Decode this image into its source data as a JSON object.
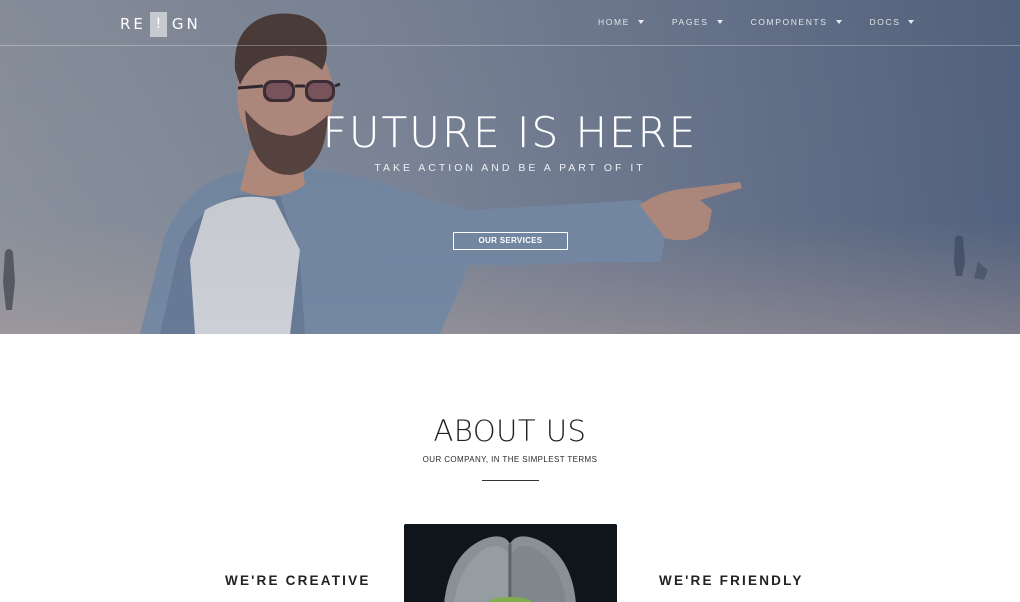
{
  "brand": {
    "prefix": "RE",
    "mark": "!",
    "suffix": "GN"
  },
  "nav": {
    "items": [
      {
        "label": "HOME"
      },
      {
        "label": "PAGES"
      },
      {
        "label": "COMPONENTS"
      },
      {
        "label": "DOCS"
      }
    ]
  },
  "hero": {
    "title": "FUTURE IS HERE",
    "subtitle": "TAKE ACTION AND BE A PART OF IT",
    "button_label": "OUR SERVICES"
  },
  "about": {
    "title": "ABOUT US",
    "subtitle": "OUR COMPANY, IN THE SIMPLEST TERMS",
    "left_heading": "WE'RE CREATIVE",
    "right_heading": "WE'RE FRIENDLY"
  },
  "colors": {
    "hero_overlay": "#5f6d86",
    "text_dark": "#1f1f1f",
    "white": "#ffffff"
  }
}
